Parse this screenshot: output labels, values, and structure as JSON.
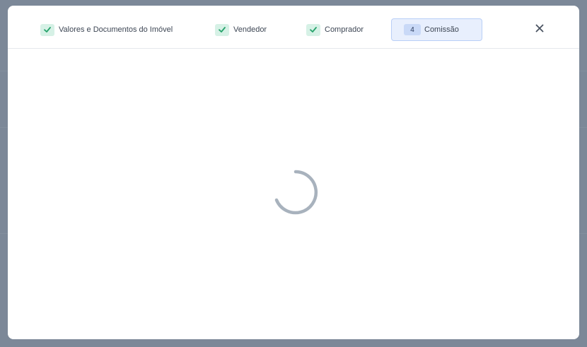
{
  "steps": [
    {
      "label": "Valores e Documentos do Imóvel",
      "status": "done",
      "icon": "check-icon"
    },
    {
      "label": "Vendedor",
      "status": "done",
      "icon": "check-icon"
    },
    {
      "label": "Comprador",
      "status": "done",
      "icon": "check-icon"
    },
    {
      "label": "Comissão",
      "status": "active",
      "number": "4"
    }
  ],
  "close_icon": "close-icon",
  "loading_icon": "spinner-icon",
  "colors": {
    "check": "#26a36b",
    "done_badge": "#d6f1e6",
    "active_border": "#b9cff7",
    "spinner": "#a8b2bd"
  }
}
